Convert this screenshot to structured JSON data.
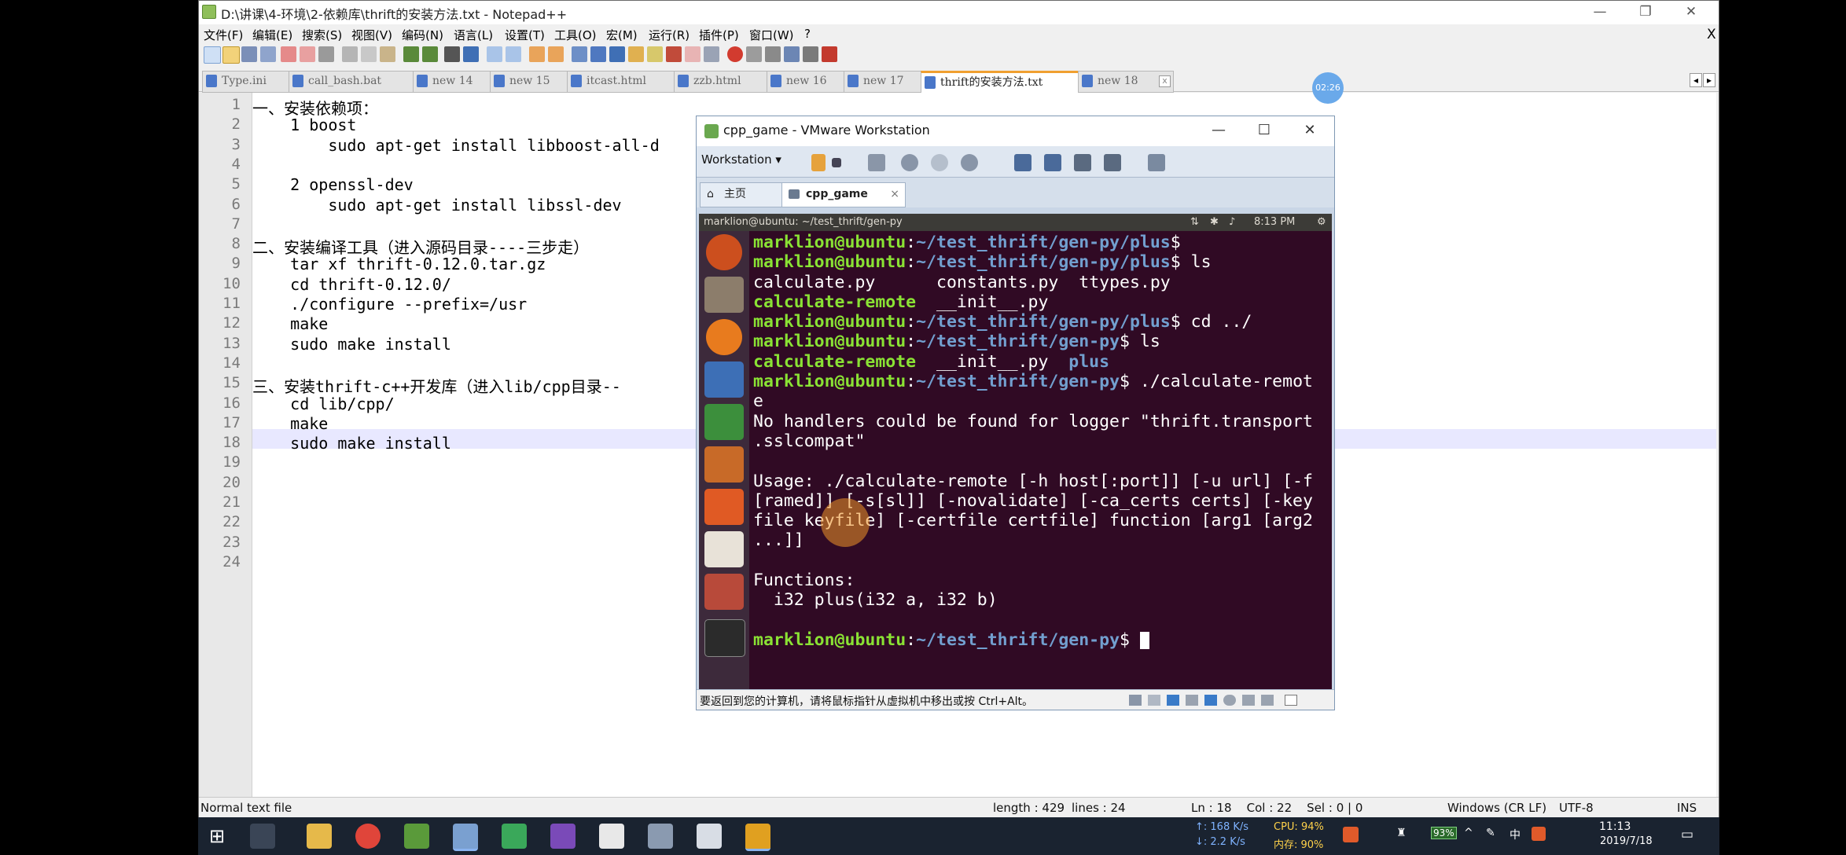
{
  "npp": {
    "title": "D:\\讲课\\4-环境\\2-依赖库\\thrift的安装方法.txt - Notepad++",
    "close_x": "X",
    "menu": [
      "文件(F)",
      "编辑(E)",
      "搜索(S)",
      "视图(V)",
      "编码(N)",
      "语言(L)",
      "设置(T)",
      "工具(O)",
      "宏(M)",
      "运行(R)",
      "插件(P)",
      "窗口(W)",
      "?"
    ],
    "tabs": [
      {
        "label": "Type.ini"
      },
      {
        "label": "call_bash.bat"
      },
      {
        "label": "new 14"
      },
      {
        "label": "new 15"
      },
      {
        "label": "itcast.html"
      },
      {
        "label": "zzb.html"
      },
      {
        "label": "new 16"
      },
      {
        "label": "new 17"
      },
      {
        "label": "thrift的安装方法.txt"
      },
      {
        "label": "new 18"
      }
    ],
    "tab_scroll_left": "◂",
    "tab_scroll_right": "▸",
    "lines": [
      {
        "n": "1",
        "t": "一、安装依赖项："
      },
      {
        "n": "2",
        "t": "    1 boost"
      },
      {
        "n": "3",
        "t": "        sudo apt-get install libboost-all-d"
      },
      {
        "n": "4",
        "t": ""
      },
      {
        "n": "5",
        "t": "    2 openssl-dev"
      },
      {
        "n": "6",
        "t": "        sudo apt-get install libssl-dev"
      },
      {
        "n": "7",
        "t": ""
      },
      {
        "n": "8",
        "t": "二、安装编译工具（进入源码目录----三步走）"
      },
      {
        "n": "9",
        "t": "    tar xf thrift-0.12.0.tar.gz"
      },
      {
        "n": "10",
        "t": "    cd thrift-0.12.0/"
      },
      {
        "n": "11",
        "t": "    ./configure --prefix=/usr"
      },
      {
        "n": "12",
        "t": "    make"
      },
      {
        "n": "13",
        "t": "    sudo make install"
      },
      {
        "n": "14",
        "t": ""
      },
      {
        "n": "15",
        "t": "三、安装thrift-c++开发库（进入lib/cpp目录--"
      },
      {
        "n": "16",
        "t": "    cd lib/cpp/"
      },
      {
        "n": "17",
        "t": "    make"
      },
      {
        "n": "18",
        "t": "    sudo make install"
      },
      {
        "n": "19",
        "t": ""
      },
      {
        "n": "20",
        "t": ""
      },
      {
        "n": "21",
        "t": ""
      },
      {
        "n": "22",
        "t": ""
      },
      {
        "n": "23",
        "t": ""
      },
      {
        "n": "24",
        "t": ""
      }
    ],
    "status": {
      "type": "Normal text file",
      "length": "length : 429",
      "lines": "lines : 24",
      "pos": "Ln : 18    Col : 22    Sel : 0 | 0",
      "eol": "Windows (CR LF)",
      "enc": "UTF-8",
      "mode": "INS"
    }
  },
  "time_badge": "02:26",
  "vm": {
    "title": "cpp_game - VMware Workstation",
    "workstation_menu": "Workstation ▾",
    "tab_home": "主页",
    "tab_vm": "cpp_game",
    "tab_close": "×",
    "win_min": "—",
    "win_max": "☐",
    "win_close": "✕",
    "ubuntu_title": "marklion@ubuntu: ~/test_thrift/gen-py",
    "ubuntu_time": "8:13 PM",
    "terminal": {
      "user": "marklion@ubuntu",
      "path_plus": "~/test_thrift/gen-py/plus",
      "path_genpy": "~/test_thrift/gen-py",
      "cmd_ls": "ls",
      "cmd_cd": "cd ../",
      "cmd_run": "./calculate-remot",
      "cmd_run_cont": "e",
      "file_calc_py": "calculate.py",
      "file_constants": "constants.py",
      "file_ttypes": "ttypes.py",
      "file_calc_remote": "calculate-remote",
      "file_init": "__init__.py",
      "dir_plus": "plus",
      "warn1": "No handlers could be found for logger \"thrift.transport",
      "warn2": ".sslcompat\"",
      "usage1": "Usage: ./calculate-remote [-h host[:port]] [-u url] [-f",
      "usage2": "[ramed]] [-s[sl]] [-novalidate] [-ca_certs certs] [-key",
      "usage3": "file keyfile] [-certfile certfile] function [arg1 [arg2",
      "usage4": "...]]",
      "functions": "Functions:",
      "func1": "  i32 plus(i32 a, i32 b)"
    },
    "status_msg": "要返回到您的计算机，请将鼠标指针从虚拟机中移出或按 Ctrl+Alt。"
  },
  "taskbar": {
    "net_up": "↑: 168 K/s",
    "net_down": "↓: 2.2 K/s",
    "cpu": "CPU: 94%",
    "mem": "内存: 90%",
    "battery": "93%",
    "ime": "中",
    "time": "11:13",
    "date": "2019/7/18"
  },
  "colors": {
    "terminal_bg": "#300a24",
    "prompt_user": "#8ae234",
    "prompt_path": "#729fcf",
    "npp_current_line": "#e8e8ff"
  }
}
